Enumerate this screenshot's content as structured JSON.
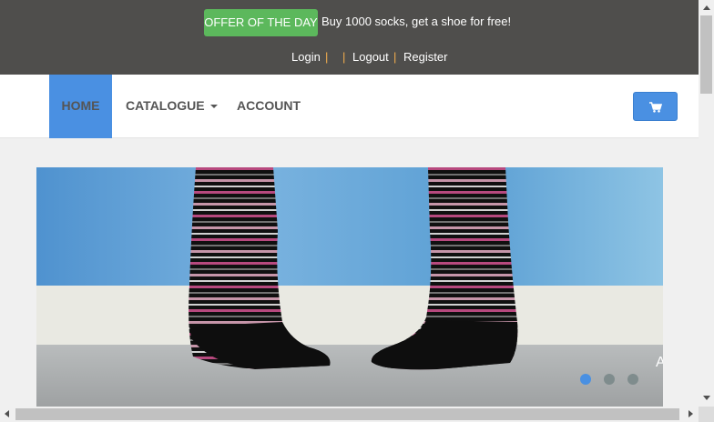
{
  "topbar": {
    "offer_button": "OFFER OF THE DAY",
    "offer_text": "Buy 1000 socks, get a shoe for free!",
    "links": {
      "login": "Login",
      "logout": "Logout",
      "register": "Register",
      "separator": "|"
    }
  },
  "nav": {
    "items": [
      {
        "label": "HOME",
        "active": true
      },
      {
        "label": "CATALOGUE",
        "dropdown": true
      },
      {
        "label": "ACCOUNT"
      }
    ],
    "cart_icon": "shopping-cart-icon"
  },
  "carousel": {
    "slide_text": "A",
    "indicators": [
      {
        "active": true
      },
      {
        "active": false
      },
      {
        "active": false
      }
    ]
  },
  "colors": {
    "topbar_bg": "#4f4e4c",
    "offer_green": "#5cb85c",
    "accent_blue": "#4a90e2",
    "separator": "#f0ad4e"
  }
}
